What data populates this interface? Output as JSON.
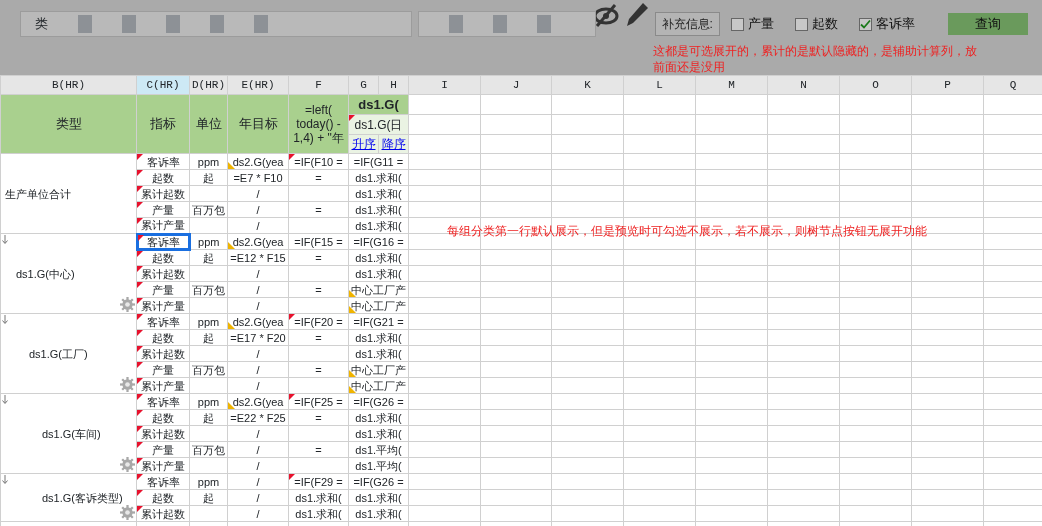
{
  "toolbar": {
    "field_label": "类",
    "info_label": "补充信息:",
    "options": [
      {
        "label": "产量",
        "checked": false
      },
      {
        "label": "起数",
        "checked": false
      },
      {
        "label": "客诉率",
        "checked": true
      }
    ],
    "query_button": "查询",
    "note": "这都是可选展开的，累计的是默认隐藏的，是辅助计算列，放前面还是没用"
  },
  "columns": [
    {
      "label": "B(HR)",
      "selected": false
    },
    {
      "label": "C(HR)",
      "selected": true
    },
    {
      "label": "D(HR)",
      "selected": false
    },
    {
      "label": "E(HR)",
      "selected": false
    },
    {
      "label": "F",
      "selected": false
    },
    {
      "label": "G",
      "selected": false
    },
    {
      "label": "H",
      "selected": false
    },
    {
      "label": "I",
      "selected": false
    },
    {
      "label": "J",
      "selected": false
    },
    {
      "label": "K",
      "selected": false
    },
    {
      "label": "L",
      "selected": false
    },
    {
      "label": "M",
      "selected": false
    },
    {
      "label": "N",
      "selected": false
    },
    {
      "label": "O",
      "selected": false
    },
    {
      "label": "P",
      "selected": false
    },
    {
      "label": "Q",
      "selected": false
    }
  ],
  "header": {
    "type": "类型",
    "indicator": "指标",
    "unit": "单位",
    "target": "年目标",
    "formula": "=left( today() - 1,4) + \"年",
    "group_title": "ds1.G(",
    "sub_title": "ds1.G(日",
    "sort_asc": "升序",
    "sort_desc": "降序"
  },
  "sheet_note": "每组分类第一行默认展示，但是预览时可勾选不展示，若不展示，则树节点按钮无展开功能",
  "groups": [
    {
      "name": "生产单位合计",
      "expandable": false,
      "rows": [
        {
          "indicator": "客诉率",
          "unit": "ppm",
          "target": "ds2.G(yea",
          "f": "=IF(F10 =",
          "g": "=IF(G11 =",
          "selected": false,
          "target_flag": true,
          "f_flag": true,
          "g_flag": false
        },
        {
          "indicator": "起数",
          "unit": "起",
          "target": "=E7 * F10",
          "f": "=",
          "g": "ds1.求和(",
          "selected": false,
          "target_flag": false,
          "f_flag": false,
          "g_flag": false
        },
        {
          "indicator": "累计起数",
          "target": "/",
          "g": "ds1.求和(",
          "selected": false,
          "target_flag": false,
          "f_flag": false,
          "g_flag": false
        },
        {
          "indicator": "产量",
          "unit": "百万包",
          "target": "/",
          "f": "=",
          "g": "ds1.求和(",
          "selected": false,
          "target_flag": false,
          "f_flag": false,
          "g_flag": false
        },
        {
          "indicator": "累计产量",
          "target": "/",
          "g": "ds1.求和(",
          "selected": false,
          "target_flag": false,
          "f_flag": false,
          "g_flag": false
        }
      ],
      "children": [
        {
          "name": "ds1.G(中心)",
          "expandable": true,
          "rows": [
            {
              "indicator": "客诉率",
              "unit": "ppm",
              "target": "ds2.G(yea",
              "f": "=IF(F15 =",
              "g": "=IF(G16 =",
              "selected": true,
              "target_flag": true,
              "f_flag": false,
              "g_flag": false
            },
            {
              "indicator": "起数",
              "unit": "起",
              "target": "=E12 * F15",
              "f": "=",
              "g": "ds1.求和(",
              "selected": false,
              "target_flag": false,
              "f_flag": false,
              "g_flag": false
            },
            {
              "indicator": "累计起数",
              "target": "/",
              "g": "ds1.求和(",
              "selected": false,
              "target_flag": false,
              "f_flag": false,
              "g_flag": false
            },
            {
              "indicator": "产量",
              "unit": "百万包",
              "target": "/",
              "f": "=",
              "g": "中心工厂产",
              "selected": false,
              "target_flag": false,
              "f_flag": false,
              "g_flag": true
            },
            {
              "indicator": "累计产量",
              "target": "/",
              "g": "中心工厂产",
              "selected": false,
              "target_flag": false,
              "f_flag": false,
              "g_flag": true
            }
          ],
          "children": [
            {
              "name": "ds1.G(工厂)",
              "expandable": true,
              "rows": [
                {
                  "indicator": "客诉率",
                  "unit": "ppm",
                  "target": "ds2.G(yea",
                  "f": "=IF(F20 =",
                  "g": "=IF(G21 =",
                  "selected": false,
                  "target_flag": true,
                  "f_flag": true,
                  "g_flag": false
                },
                {
                  "indicator": "起数",
                  "unit": "起",
                  "target": "=E17 * F20",
                  "f": "=",
                  "g": "ds1.求和(",
                  "selected": false,
                  "target_flag": false,
                  "f_flag": false,
                  "g_flag": false
                },
                {
                  "indicator": "累计起数",
                  "target": "/",
                  "g": "ds1.求和(",
                  "selected": false,
                  "target_flag": false,
                  "f_flag": false,
                  "g_flag": false
                },
                {
                  "indicator": "产量",
                  "unit": "百万包",
                  "target": "/",
                  "f": "=",
                  "g": "中心工厂产",
                  "selected": false,
                  "target_flag": false,
                  "f_flag": false,
                  "g_flag": true
                },
                {
                  "indicator": "累计产量",
                  "target": "/",
                  "g": "中心工厂产",
                  "selected": false,
                  "target_flag": false,
                  "f_flag": false,
                  "g_flag": true
                }
              ],
              "children": [
                {
                  "name": "ds1.G(车间)",
                  "expandable": true,
                  "rows": [
                    {
                      "indicator": "客诉率",
                      "unit": "ppm",
                      "target": "ds2.G(yea",
                      "f": "=IF(F25 =",
                      "g": "=IF(G26 =",
                      "selected": false,
                      "target_flag": true,
                      "f_flag": true,
                      "g_flag": false
                    },
                    {
                      "indicator": "起数",
                      "unit": "起",
                      "target": "=E22 * F25",
                      "f": "=",
                      "g": "ds1.求和(",
                      "selected": false,
                      "target_flag": false,
                      "f_flag": false,
                      "g_flag": false
                    },
                    {
                      "indicator": "累计起数",
                      "target": "/",
                      "g": "ds1.求和(",
                      "selected": false,
                      "target_flag": false,
                      "f_flag": false,
                      "g_flag": false
                    },
                    {
                      "indicator": "产量",
                      "unit": "百万包",
                      "target": "/",
                      "f": "=",
                      "g": "ds1.平均(",
                      "selected": false,
                      "target_flag": false,
                      "f_flag": false,
                      "g_flag": false
                    },
                    {
                      "indicator": "累计产量",
                      "target": "/",
                      "g": "ds1.平均(",
                      "selected": false,
                      "target_flag": false,
                      "f_flag": false,
                      "g_flag": false
                    }
                  ],
                  "children": [
                    {
                      "name": "ds1.G(客诉类型)",
                      "expandable": true,
                      "rows": [
                        {
                          "indicator": "客诉率",
                          "unit": "ppm",
                          "target": "/",
                          "f": "=IF(F29 =",
                          "g": "=IF(G26 =",
                          "selected": false,
                          "target_flag": false,
                          "f_flag": true,
                          "g_flag": false
                        },
                        {
                          "indicator": "起数",
                          "unit": "起",
                          "target": "/",
                          "f": "ds1.求和(",
                          "g": "ds1.求和(",
                          "selected": false,
                          "target_flag": false,
                          "f_flag": false,
                          "g_flag": false
                        },
                        {
                          "indicator": "累计起数",
                          "target": "/",
                          "f": "ds1.求和(",
                          "g": "ds1.求和(",
                          "selected": false,
                          "target_flag": false,
                          "f_flag": false,
                          "g_flag": false
                        }
                      ]
                    }
                  ]
                }
              ]
            }
          ]
        }
      ]
    }
  ]
}
